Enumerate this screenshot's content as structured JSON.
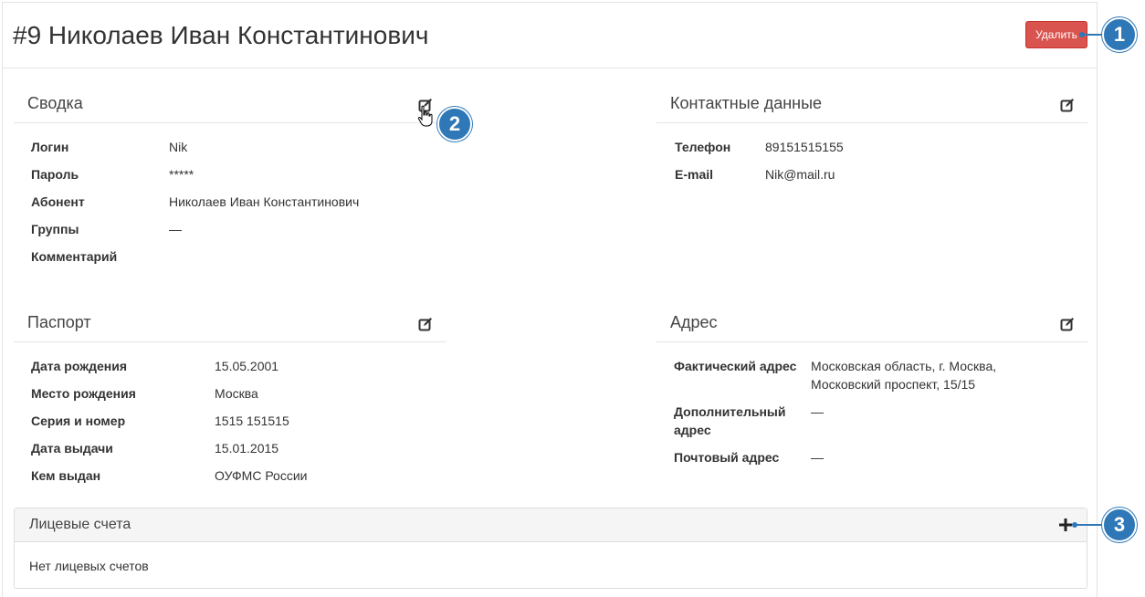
{
  "header": {
    "title": "#9 Николаев Иван Константинович",
    "delete_label": "Удалить"
  },
  "summary": {
    "title": "Сводка",
    "rows": [
      {
        "label": "Логин",
        "value": "Nik"
      },
      {
        "label": "Пароль",
        "value": "*****"
      },
      {
        "label": "Абонент",
        "value": "Николаев Иван Константинович"
      },
      {
        "label": "Группы",
        "value": "—"
      },
      {
        "label": "Комментарий",
        "value": ""
      }
    ]
  },
  "contacts": {
    "title": "Контактные данные",
    "rows": [
      {
        "label": "Телефон",
        "value": "89151515155"
      },
      {
        "label": "E-mail",
        "value": "Nik@mail.ru"
      }
    ]
  },
  "passport": {
    "title": "Паспорт",
    "rows": [
      {
        "label": "Дата рождения",
        "value": "15.05.2001"
      },
      {
        "label": "Место рождения",
        "value": "Москва"
      },
      {
        "label": "Серия и номер",
        "value": "1515 151515"
      },
      {
        "label": "Дата выдачи",
        "value": "15.01.2015"
      },
      {
        "label": "Кем выдан",
        "value": "ОУФМС России"
      }
    ]
  },
  "address": {
    "title": "Адрес",
    "rows": [
      {
        "label_line1": "Фактический адрес",
        "label_line2": "",
        "value_line1": "Московская область, г. Москва,",
        "value_line2": "Московский проспект, 15/15"
      },
      {
        "label_line1": "Дополнительный",
        "label_line2": "адрес",
        "value_line1": "—",
        "value_line2": ""
      },
      {
        "label_line1": "Почтовый адрес",
        "label_line2": "",
        "value_line1": "—",
        "value_line2": ""
      }
    ]
  },
  "accounts": {
    "title": "Лицевые счета",
    "empty_text": "Нет лицевых счетов"
  },
  "callouts": [
    "1",
    "2",
    "3"
  ],
  "icons": {
    "edit": "edit-icon",
    "add": "plus-icon",
    "cursor": "hand-pointer-icon"
  },
  "colors": {
    "danger": "#d9534f",
    "callout": "#2f78b7"
  }
}
